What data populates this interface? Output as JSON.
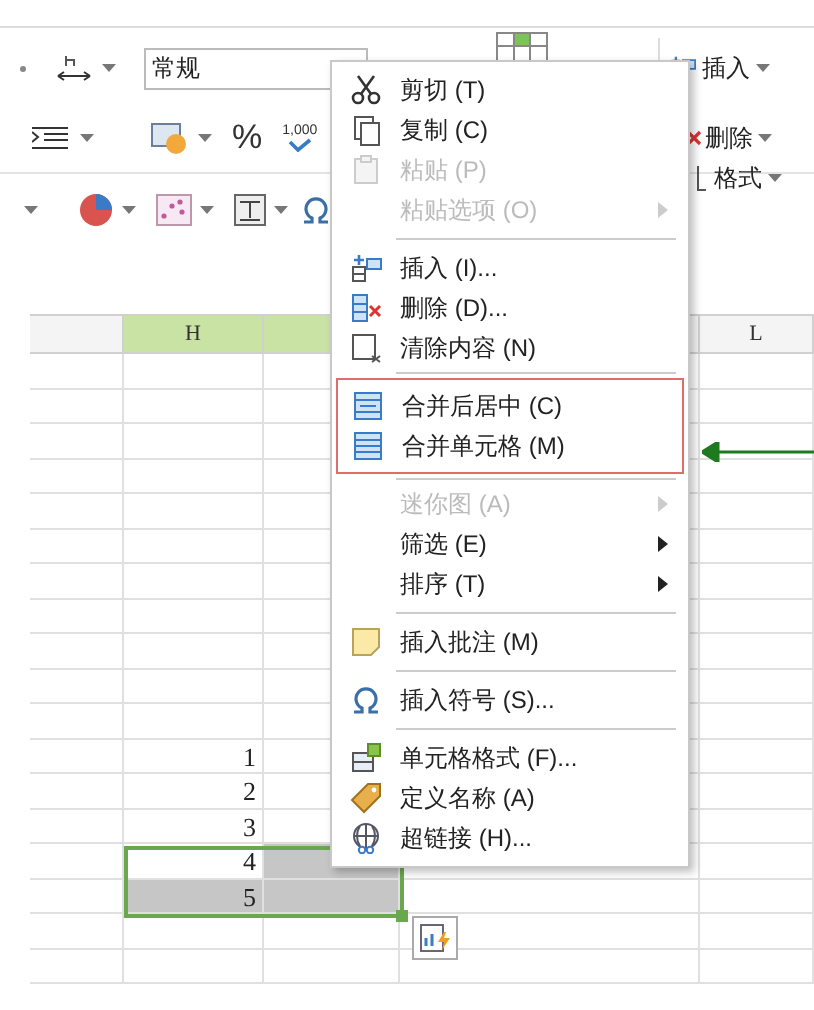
{
  "ribbon": {
    "number_format": {
      "value": "常规"
    },
    "right_buttons": [
      {
        "label": "插入"
      },
      {
        "label": "删除"
      },
      {
        "label": "格式"
      }
    ],
    "percent": "%",
    "thousands": "1,000"
  },
  "sheet": {
    "columns": [
      {
        "selected": false
      },
      {
        "label": "H",
        "selected": true
      },
      {
        "selected": true
      },
      {
        "selected": false
      },
      {
        "label": "L",
        "selected": false
      }
    ],
    "values": [
      {
        "text": "1",
        "selected": false
      },
      {
        "text": "2",
        "selected": false
      },
      {
        "text": "3",
        "selected": false
      },
      {
        "text": "4",
        "selected": true
      },
      {
        "text": "5",
        "selected": true
      }
    ]
  },
  "context_menu": {
    "groups": [
      {
        "outlined": false,
        "items": [
          {
            "label": "剪切 (T)",
            "disabled": false,
            "submenu": false
          },
          {
            "label": "复制 (C)",
            "disabled": false,
            "submenu": false
          },
          {
            "label": "粘贴 (P)",
            "disabled": true,
            "submenu": false
          },
          {
            "label": "粘贴选项 (O)",
            "disabled": true,
            "submenu": true
          }
        ]
      },
      {
        "outlined": false,
        "items": [
          {
            "label": "插入 (I)...",
            "disabled": false,
            "submenu": false
          },
          {
            "label": "删除 (D)...",
            "disabled": false,
            "submenu": false
          },
          {
            "label": "清除内容 (N)",
            "disabled": false,
            "submenu": false
          }
        ]
      },
      {
        "outlined": true,
        "items": [
          {
            "label": "合并后居中 (C)",
            "disabled": false,
            "submenu": false
          },
          {
            "label": "合并单元格 (M)",
            "disabled": false,
            "submenu": false
          }
        ]
      },
      {
        "outlined": false,
        "items": [
          {
            "label": "迷你图 (A)",
            "disabled": true,
            "submenu": true
          },
          {
            "label": "筛选 (E)",
            "disabled": false,
            "submenu": true
          },
          {
            "label": "排序 (T)",
            "disabled": false,
            "submenu": true
          }
        ]
      },
      {
        "outlined": false,
        "items": [
          {
            "label": "插入批注 (M)",
            "disabled": false,
            "submenu": false
          }
        ]
      },
      {
        "outlined": false,
        "items": [
          {
            "label": "插入符号 (S)...",
            "disabled": false,
            "submenu": false
          }
        ]
      },
      {
        "outlined": false,
        "items": [
          {
            "label": "单元格格式 (F)...",
            "disabled": false,
            "submenu": false
          },
          {
            "label": "定义名称 (A)",
            "disabled": false,
            "submenu": false
          },
          {
            "label": "超链接 (H)...",
            "disabled": false,
            "submenu": false
          }
        ]
      }
    ]
  }
}
